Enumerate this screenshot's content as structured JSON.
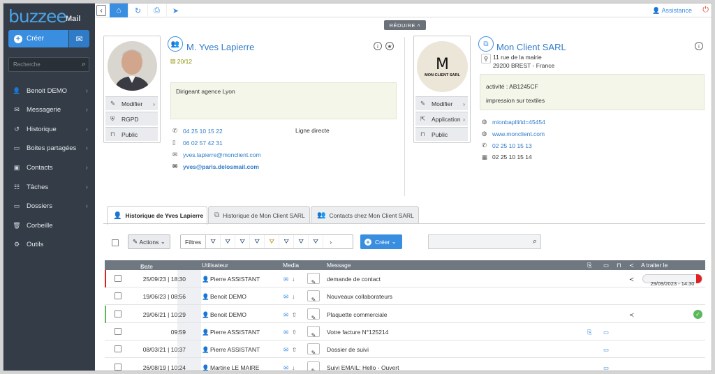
{
  "sidebar": {
    "logo": "buzzee",
    "logo_suffix": "Mail",
    "create_label": "Créer",
    "search_placeholder": "Recherche",
    "items": [
      {
        "label": "Benoit DEMO",
        "icon": "user-icon",
        "chevron": true
      },
      {
        "label": "Messagerie",
        "icon": "envelope-icon",
        "chevron": true
      },
      {
        "label": "Historique",
        "icon": "history-icon",
        "chevron": true
      },
      {
        "label": "Boites partagées",
        "icon": "folder-icon",
        "chevron": true
      },
      {
        "label": "Contacts",
        "icon": "address-book-icon",
        "chevron": true
      },
      {
        "label": "Tâches",
        "icon": "tasks-icon",
        "chevron": true
      },
      {
        "label": "Dossiers",
        "icon": "folder-icon",
        "chevron": true
      },
      {
        "label": "Corbeille",
        "icon": "trash-icon",
        "chevron": false
      },
      {
        "label": "Outils",
        "icon": "cogs-icon",
        "chevron": false
      }
    ]
  },
  "topbar": {
    "assistance_label": "Assistance",
    "reduire_label": "RÉDUIRE"
  },
  "contact": {
    "name": "M. Yves Lapierre",
    "score": "20/12",
    "note": "Dirigeant agence Lyon",
    "actions": [
      "Modifier",
      "RGPD",
      "Public"
    ],
    "phone1": "04 25 10 15 22",
    "phone1_label": "Ligne directe",
    "mobile": "06 02 57 42 31",
    "email1": "yves.lapierre@monclient.com",
    "email2": "yves@paris.delosmail.com"
  },
  "company": {
    "name": "Mon Client SARL",
    "logo_letter": "M",
    "logo_text": "MON CLIENT SARL",
    "address1": "11 rue de la mairie",
    "address2": "29200 BREST - France",
    "note_line1": "activité : AB1245CF",
    "note_line2": "impression sur textiles",
    "actions": [
      "Modifier",
      "Application",
      "Public"
    ],
    "app_link": "mionbaplli/id=45454",
    "website": "www.monclient.com",
    "phone": "02 25 10 15 13",
    "fax": "02 25 10 15 14"
  },
  "tabs": [
    {
      "label": "Historique de Yves Lapierre",
      "active": true
    },
    {
      "label": "Historique de Mon Client SARL",
      "active": false
    },
    {
      "label": "Contacts chez Mon Client SARL",
      "active": false
    }
  ],
  "toolbar": {
    "actions_label": "Actions",
    "filters_label": "Filtres",
    "create_label": "Créer"
  },
  "table": {
    "headers": {
      "date": "Date",
      "user": "Utilisateur",
      "media": "Media",
      "message": "Message",
      "todo": "A traiter le"
    },
    "rows": [
      {
        "date": "25/09/23 | 18:30",
        "user": "Pierre ASSISTANT",
        "message": "demande de contact",
        "mark": "#e02020",
        "media_dir": "in",
        "share": true,
        "due": "29/09/2023 - 14:30",
        "attach": false,
        "folder": false,
        "ok": false
      },
      {
        "date": "19/06/23 | 08:56",
        "user": "Benoit DEMO",
        "message": "Nouveaux collaborateurs",
        "mark": "",
        "media_dir": "in",
        "share": false,
        "due": "",
        "attach": false,
        "folder": false,
        "ok": false
      },
      {
        "date": "29/06/21 | 10:29",
        "user": "Benoit DEMO",
        "message": "Plaquette commerciale",
        "mark": "#5cb85c",
        "media_dir": "out",
        "share": true,
        "due": "",
        "attach": false,
        "folder": false,
        "ok": true
      },
      {
        "date": "09:59",
        "user": "Pierre ASSISTANT",
        "message": "Votre facture N°125214",
        "mark": "",
        "media_dir": "out",
        "share": false,
        "due": "",
        "attach": true,
        "folder": true,
        "ok": false
      },
      {
        "date": "08/03/21 | 10:37",
        "user": "Pierre ASSISTANT",
        "message": "Dossier de suivi",
        "mark": "",
        "media_dir": "out",
        "share": false,
        "due": "",
        "attach": false,
        "folder": true,
        "ok": false
      },
      {
        "date": "26/08/19 | 10:24",
        "user": "Martine LE MAIRE",
        "message": "Suivi EMAIL: Hello - Ouvert",
        "mark": "",
        "media_dir": "in",
        "share": false,
        "due": "",
        "attach": false,
        "folder": true,
        "ok": false
      }
    ]
  },
  "colors": {
    "accent": "#3a8ee0",
    "sidebar_bg": "#343c47",
    "red_mark": "#e02020",
    "green_mark": "#5cb85c"
  }
}
